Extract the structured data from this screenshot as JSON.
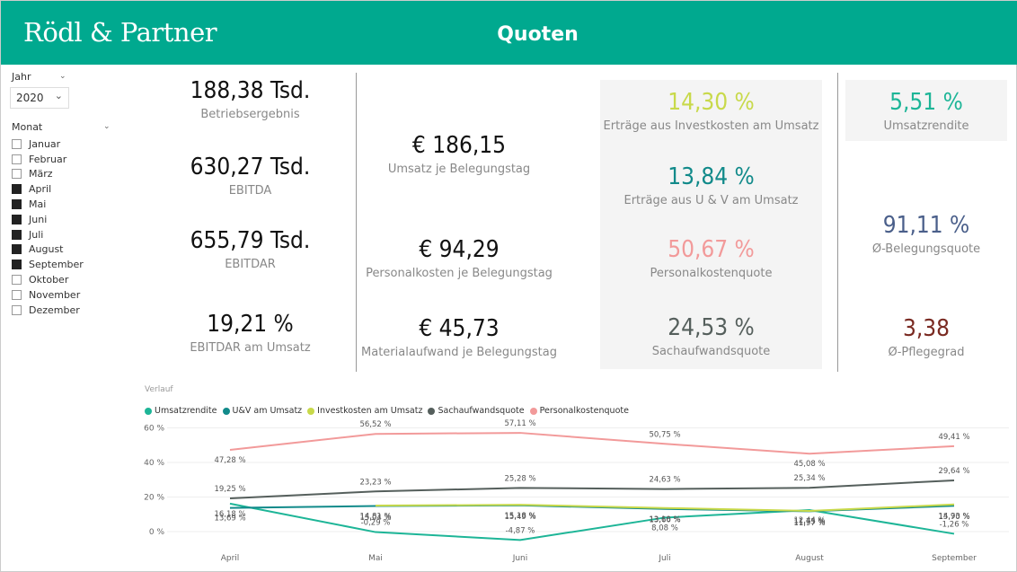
{
  "header": {
    "logo": "Rödl & Partner",
    "title": "Quoten"
  },
  "filters": {
    "year_label": "Jahr",
    "year_value": "2020",
    "month_label": "Monat",
    "months": [
      {
        "label": "Januar",
        "checked": false
      },
      {
        "label": "Februar",
        "checked": false
      },
      {
        "label": "März",
        "checked": false
      },
      {
        "label": "April",
        "checked": true
      },
      {
        "label": "Mai",
        "checked": true
      },
      {
        "label": "Juni",
        "checked": true
      },
      {
        "label": "Juli",
        "checked": true
      },
      {
        "label": "August",
        "checked": true
      },
      {
        "label": "September",
        "checked": true
      },
      {
        "label": "Oktober",
        "checked": false
      },
      {
        "label": "November",
        "checked": false
      },
      {
        "label": "Dezember",
        "checked": false
      }
    ]
  },
  "kpis": {
    "betriebsergebnis": {
      "value": "188,38 Tsd.",
      "label": "Betriebsergebnis"
    },
    "ebitda": {
      "value": "630,27 Tsd.",
      "label": "EBITDA"
    },
    "ebitdar": {
      "value": "655,79 Tsd.",
      "label": "EBITDAR"
    },
    "ebitdar_umsatz": {
      "value": "19,21 %",
      "label": "EBITDAR am Umsatz"
    },
    "umsatz_tag": {
      "value": "€ 186,15",
      "label": "Umsatz je Belegungstag"
    },
    "personal_tag": {
      "value": "€ 94,29",
      "label": "Personalkosten je Belegungstag"
    },
    "material_tag": {
      "value": "€ 45,73",
      "label": "Materialaufwand je Belegungstag"
    },
    "invest": {
      "value": "14,30 %",
      "label": "Erträge aus Investkosten am Umsatz",
      "color": "#c8d94a"
    },
    "uv": {
      "value": "13,84 %",
      "label": "Erträge aus U & V am Umsatz",
      "color": "#118a8a"
    },
    "personalquote": {
      "value": "50,67 %",
      "label": "Personalkostenquote",
      "color": "#f29a9a"
    },
    "sachquote": {
      "value": "24,53 %",
      "label": "Sachaufwandsquote",
      "color": "#555f5c"
    },
    "umsatzrendite": {
      "value": "5,51 %",
      "label": "Umsatzrendite",
      "color": "#1db597"
    },
    "belegung": {
      "value": "91,11 %",
      "label": "Ø-Belegungsquote",
      "color": "#4a5f8a"
    },
    "pflegegrad": {
      "value": "3,38",
      "label": "Ø-Pflegegrad",
      "color": "#7a2a22"
    }
  },
  "chart_data": {
    "type": "line",
    "title": "Verlauf",
    "categories": [
      "April",
      "Mai",
      "Juni",
      "Juli",
      "August",
      "September"
    ],
    "y_ticks": [
      "60 %",
      "40 %",
      "20 %",
      "0 %"
    ],
    "ylim": [
      -10,
      60
    ],
    "grid": true,
    "legend_position": "top-left",
    "series": [
      {
        "name": "Umsatzrendite",
        "color": "#1db597",
        "values": [
          16.18,
          -0.29,
          -4.87,
          8.08,
          12.44,
          -1.26
        ],
        "labels": [
          "16,18 %",
          "-0,29 %",
          "-4,87 %",
          "8,08 %",
          "12,44 %",
          "-1,26 %"
        ]
      },
      {
        "name": "U&V am Umsatz",
        "color": "#118a8a",
        "values": [
          13.69,
          14.81,
          15.18,
          13.1,
          11.75,
          14.93
        ],
        "labels": [
          "13,69 %",
          "14,81 %",
          "15,18 %",
          "13,10 %",
          "11,75 %",
          "14,93 %"
        ]
      },
      {
        "name": "Investkosten am Umsatz",
        "color": "#c8d94a",
        "values": [
          null,
          15.04,
          15.49,
          13.66,
          11.97,
          15.7
        ],
        "labels": [
          "",
          "15,04 %",
          "15,49 %",
          "13,66 %",
          "11,97 %",
          "15,70 %"
        ]
      },
      {
        "name": "Sachaufwandsquote",
        "color": "#555f5c",
        "values": [
          19.25,
          23.23,
          25.28,
          24.63,
          25.34,
          29.64
        ],
        "labels": [
          "19,25 %",
          "23,23 %",
          "25,28 %",
          "24,63 %",
          "25,34 %",
          "29,64 %"
        ]
      },
      {
        "name": "Personalkostenquote",
        "color": "#f29a9a",
        "values": [
          47.28,
          56.52,
          57.11,
          50.75,
          45.08,
          49.41
        ],
        "labels": [
          "47,28 %",
          "56,52 %",
          "57,11 %",
          "50,75 %",
          "45,08 %",
          "49,41 %"
        ]
      }
    ]
  }
}
